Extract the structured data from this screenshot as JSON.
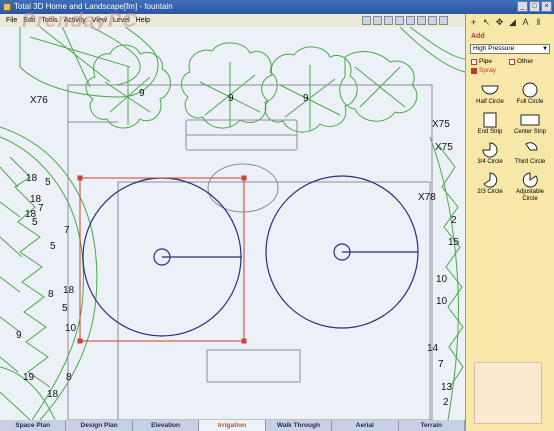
{
  "window": {
    "title": "Total 3D Home and Landscape[fm] - fountain"
  },
  "watermark": "PrendayPC",
  "menu": [
    "File",
    "Edit",
    "Tools",
    "Activity",
    "View",
    "Level",
    "Help"
  ],
  "canvas_labels": [
    {
      "key": "l1",
      "text": "X76"
    },
    {
      "key": "l2",
      "text": "9"
    },
    {
      "key": "l3",
      "text": "9"
    },
    {
      "key": "l4",
      "text": "9"
    },
    {
      "key": "l5",
      "text": "X75"
    },
    {
      "key": "l6",
      "text": "X75"
    },
    {
      "key": "l7",
      "text": "X78"
    },
    {
      "key": "l8",
      "text": "18"
    },
    {
      "key": "l9",
      "text": "5"
    },
    {
      "key": "l10",
      "text": "18"
    },
    {
      "key": "l11",
      "text": "7"
    },
    {
      "key": "l12",
      "text": "18"
    },
    {
      "key": "l13",
      "text": "5"
    },
    {
      "key": "l14",
      "text": "7"
    },
    {
      "key": "l15",
      "text": "5"
    },
    {
      "key": "l16",
      "text": "8"
    },
    {
      "key": "l17",
      "text": "18"
    },
    {
      "key": "l18",
      "text": "5"
    },
    {
      "key": "l19",
      "text": "10"
    },
    {
      "key": "l20",
      "text": "9"
    },
    {
      "key": "l21",
      "text": "19"
    },
    {
      "key": "l22",
      "text": "8"
    },
    {
      "key": "l23",
      "text": "18"
    },
    {
      "key": "l24",
      "text": "2"
    },
    {
      "key": "l25",
      "text": "15"
    },
    {
      "key": "l26",
      "text": "10"
    },
    {
      "key": "l27",
      "text": "10"
    },
    {
      "key": "l28",
      "text": "14"
    },
    {
      "key": "l29",
      "text": "7"
    },
    {
      "key": "l30",
      "text": "13"
    },
    {
      "key": "l31",
      "text": "2"
    }
  ],
  "tabs": [
    "Space Plan",
    "Design Plan",
    "Elevation",
    "Irrigation",
    "Walk Through",
    "Aerial",
    "Terrain"
  ],
  "active_tab": "Irrigation",
  "panel": {
    "add_label": "Add",
    "pressure": "High Pressure",
    "options": {
      "pipe": "Pipe",
      "other": "Other",
      "spray": "Spray"
    },
    "sprinklers": [
      "Half Circle",
      "Full Circle",
      "End Strip",
      "Center Strip",
      "3/4 Circle",
      "Third Circle",
      "2/3 Circle",
      "Adjustable Circle"
    ]
  },
  "colors": {
    "plant_green": "#4aa84a",
    "circle_blue": "#2a2f7a",
    "selection_red": "#d04030",
    "panel_bg": "#f7e8a9"
  }
}
